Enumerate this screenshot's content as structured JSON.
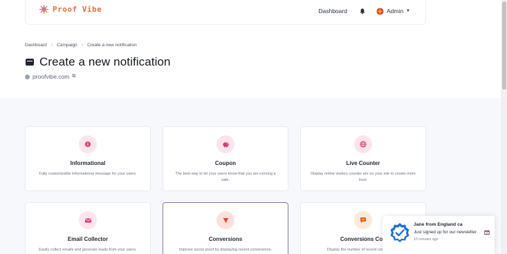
{
  "app": {
    "logo_text": "Proof Vibe",
    "colors": {
      "brand": "#e0703a",
      "accent": "#8a6fb4",
      "badge": "#1e6fd9"
    }
  },
  "nav": {
    "dashboard_label": "Dashboard",
    "admin_label": "Admin",
    "bell_icon": "bell-icon",
    "avatar_icon": "avatar-icon"
  },
  "breadcrumb": {
    "items": [
      "Dashboard",
      "Campaign",
      "Create a new notification"
    ]
  },
  "page": {
    "title": "Create a new notification",
    "site": "proofvibe.com"
  },
  "cards": [
    {
      "title": "Informational",
      "desc": "Fully customizable informational message for your users.",
      "icon": "info-icon"
    },
    {
      "title": "Coupon",
      "desc": "The best way to let your users know that you are running a sale.",
      "icon": "piggy-bank-icon"
    },
    {
      "title": "Live Counter",
      "desc": "Display online visitors counter are on your site to create more trust.",
      "icon": "globe-icon"
    },
    {
      "title": "Email Collector",
      "desc": "Easily collect emails and generate leads from your users.",
      "icon": "envelope-icon"
    },
    {
      "title": "Conversions",
      "desc": "Improve social proof by displaying recent conversions.",
      "icon": "megaphone-icon"
    },
    {
      "title": "Conversions Cou",
      "desc": "Display the number of recent conversions.",
      "icon": "chat-bubble-icon"
    }
  ],
  "toast": {
    "name": "Jane from England ca",
    "message": "Just signed up for our newsletter",
    "time": "10 minutes ago"
  }
}
